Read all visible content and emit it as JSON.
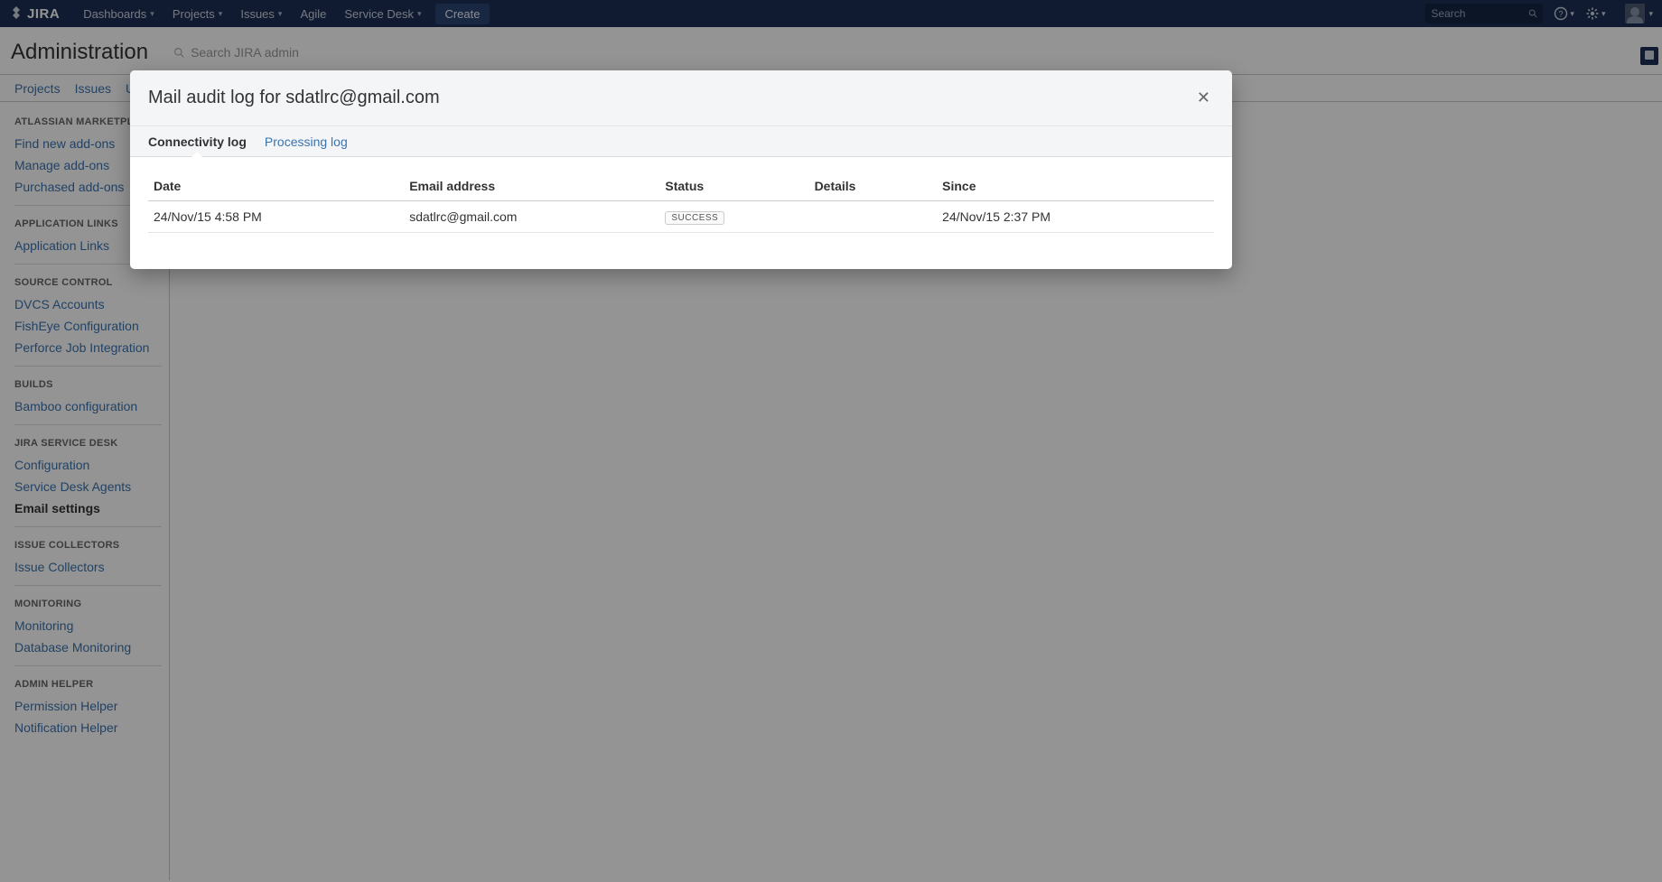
{
  "topnav": {
    "logo_text": "JIRA",
    "items": [
      "Dashboards",
      "Projects",
      "Issues",
      "Agile",
      "Service Desk"
    ],
    "create_label": "Create",
    "search_placeholder": "Search"
  },
  "admin": {
    "title": "Administration",
    "search_placeholder": "Search JIRA admin",
    "tabs": [
      "Projects",
      "Issues",
      "User"
    ]
  },
  "sidebar": [
    {
      "title": "ATLASSIAN MARKETPLACE",
      "items": [
        "Find new add-ons",
        "Manage add-ons",
        "Purchased add-ons"
      ]
    },
    {
      "title": "APPLICATION LINKS",
      "items": [
        "Application Links"
      ]
    },
    {
      "title": "SOURCE CONTROL",
      "items": [
        "DVCS Accounts",
        "FishEye Configuration",
        "Perforce Job Integration"
      ]
    },
    {
      "title": "BUILDS",
      "items": [
        "Bamboo configuration"
      ]
    },
    {
      "title": "JIRA SERVICE DESK",
      "items": [
        "Configuration",
        "Service Desk Agents",
        "Email settings"
      ],
      "selected_index": 2
    },
    {
      "title": "ISSUE COLLECTORS",
      "items": [
        "Issue Collectors"
      ]
    },
    {
      "title": "MONITORING",
      "items": [
        "Monitoring",
        "Database Monitoring"
      ]
    },
    {
      "title": "ADMIN HELPER",
      "items": [
        "Permission Helper",
        "Notification Helper"
      ]
    }
  ],
  "modal": {
    "title": "Mail audit log for sdatlrc@gmail.com",
    "tabs": [
      "Connectivity log",
      "Processing log"
    ],
    "active_tab_index": 0,
    "columns": [
      "Date",
      "Email address",
      "Status",
      "Details",
      "Since"
    ],
    "rows": [
      {
        "date": "24/Nov/15 4:58 PM",
        "email": "sdatlrc@gmail.com",
        "status": "SUCCESS",
        "details": "",
        "since": "24/Nov/15 2:37 PM"
      }
    ]
  }
}
